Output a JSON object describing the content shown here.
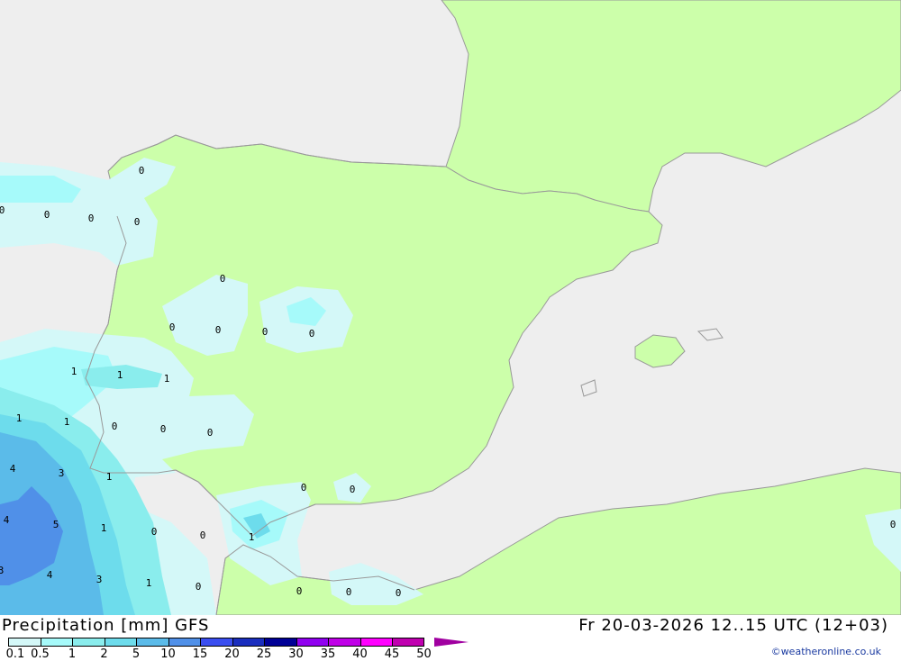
{
  "map": {
    "colors": {
      "sea": "#eeeeee",
      "land": "#ccffaa",
      "coast": "#999999"
    },
    "labels": [
      "0",
      "0",
      "0",
      "0",
      "0",
      "0",
      "0",
      "0",
      "0",
      "0",
      "0",
      "1",
      "1",
      "1",
      "1",
      "1",
      "0",
      "0",
      "0",
      "4",
      "3",
      "1",
      "4",
      "5",
      "1",
      "0",
      "0",
      "1",
      "3",
      "4",
      "3",
      "1",
      "0",
      "0",
      "0",
      "0",
      "0",
      "0",
      "0"
    ]
  },
  "legend": {
    "title": "Precipitation [mm] GFS",
    "levels": [
      "0.1",
      "0.5",
      "1",
      "2",
      "5",
      "10",
      "15",
      "20",
      "25",
      "30",
      "35",
      "40",
      "45",
      "50"
    ],
    "colors": [
      "#d4f8f8",
      "#a6fafa",
      "#8aeded",
      "#6ddcec",
      "#5bbbe9",
      "#5090e8",
      "#3a4ef0",
      "#1a2ebe",
      "#000096",
      "#9000f0",
      "#c000e8",
      "#ff00ff",
      "#c000b0"
    ],
    "overflow_color": "#a000a0"
  },
  "datetime": "Fr 20-03-2026 12..15 UTC (12+03)",
  "credit": "©weatheronline.co.uk"
}
